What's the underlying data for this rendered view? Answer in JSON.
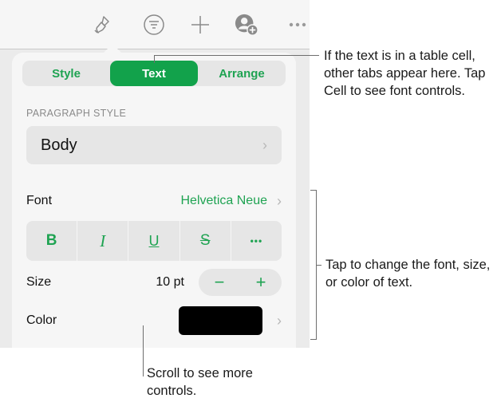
{
  "toolbar": {
    "icons": [
      "paintbrush-icon",
      "filter-icon",
      "plus-icon",
      "collaborate-icon",
      "more-icon"
    ]
  },
  "popover": {
    "tabs": [
      {
        "label": "Style",
        "active": false
      },
      {
        "label": "Text",
        "active": true
      },
      {
        "label": "Arrange",
        "active": false
      }
    ],
    "paragraph_style": {
      "section_label": "PARAGRAPH STYLE",
      "value": "Body"
    },
    "font": {
      "label": "Font",
      "value": "Helvetica Neue"
    },
    "format_buttons": [
      {
        "name": "bold",
        "glyph": "B"
      },
      {
        "name": "italic",
        "glyph": "I"
      },
      {
        "name": "underline",
        "glyph": "U"
      },
      {
        "name": "strikethrough",
        "glyph": "S"
      },
      {
        "name": "more",
        "glyph": "•••"
      }
    ],
    "size": {
      "label": "Size",
      "value": "10 pt",
      "decrement": "−",
      "increment": "+"
    },
    "color": {
      "label": "Color",
      "swatch": "#000000"
    },
    "chevron": "›"
  },
  "callouts": {
    "tabs": "If the text is in a table cell, other tabs appear here. Tap Cell to see font controls.",
    "font_controls": "Tap to change the font, size, or color of text.",
    "scroll": "Scroll to see more controls."
  },
  "colors": {
    "accent": "#12a24b",
    "accent_text": "#1fa352",
    "panel": "#f6f6f6",
    "control": "#e6e6e6"
  }
}
